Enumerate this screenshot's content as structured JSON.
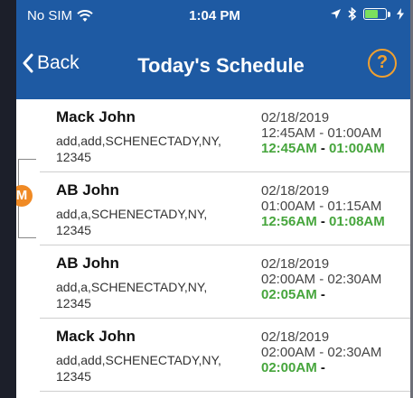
{
  "status_bar": {
    "carrier": "No SIM",
    "time": "1:04 PM"
  },
  "nav": {
    "back_label": "Back",
    "title": "Today's Schedule",
    "help_label": "?"
  },
  "merge_badge": "M",
  "schedule": [
    {
      "name": "Mack John",
      "address": "add,add,SCHENECTADY,NY, 12345",
      "date": "02/18/2019",
      "scheduled": "12:45AM - 01:00AM",
      "actual_start": "12:45AM",
      "actual_sep": " - ",
      "actual_end": "01:00AM"
    },
    {
      "name": "AB John",
      "address": "add,a,SCHENECTADY,NY, 12345",
      "date": "02/18/2019",
      "scheduled": "01:00AM - 01:15AM",
      "actual_start": "12:56AM",
      "actual_sep": " - ",
      "actual_end": "01:08AM"
    },
    {
      "name": "AB John",
      "address": "add,a,SCHENECTADY,NY, 12345",
      "date": "02/18/2019",
      "scheduled": "02:00AM - 02:30AM",
      "actual_start": "02:05AM",
      "actual_sep": " -",
      "actual_end": ""
    },
    {
      "name": "Mack John",
      "address": "add,add,SCHENECTADY,NY, 12345",
      "date": "02/18/2019",
      "scheduled": "02:00AM - 02:30AM",
      "actual_start": "02:00AM",
      "actual_sep": " -",
      "actual_end": ""
    }
  ],
  "colors": {
    "nav_blue": "#1e5aa3",
    "accent_orange": "#f08a24",
    "actual_green": "#46a53c"
  }
}
